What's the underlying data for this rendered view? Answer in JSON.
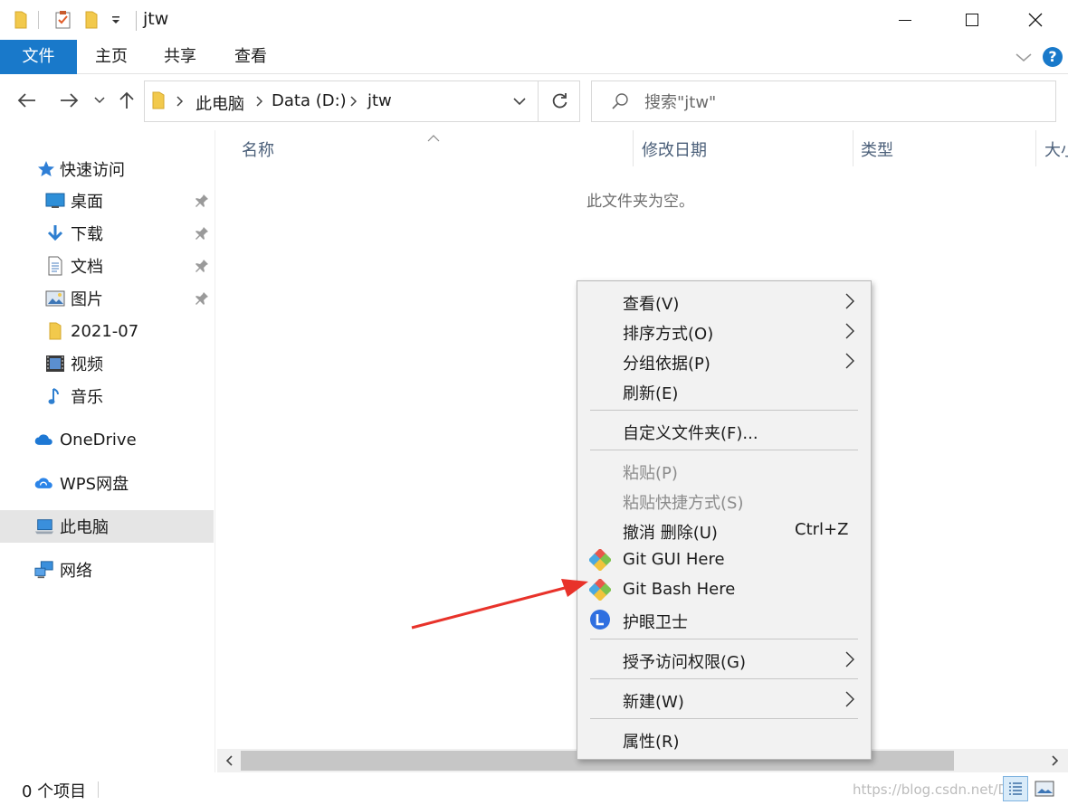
{
  "window": {
    "title": "jtw"
  },
  "ribbon": {
    "tabs": [
      {
        "label": "文件"
      },
      {
        "label": "主页"
      },
      {
        "label": "共享"
      },
      {
        "label": "查看"
      }
    ],
    "help": "?"
  },
  "address": {
    "crumbs": [
      "此电脑",
      "Data (D:)",
      "jtw"
    ]
  },
  "search": {
    "placeholder": "搜索\"jtw\""
  },
  "sidebar": {
    "items": [
      {
        "label": "快速访问",
        "icon": "star-icon"
      },
      {
        "label": "桌面",
        "icon": "desktop-icon",
        "pinned": true
      },
      {
        "label": "下载",
        "icon": "download-icon",
        "pinned": true
      },
      {
        "label": "文档",
        "icon": "document-icon",
        "pinned": true
      },
      {
        "label": "图片",
        "icon": "picture-icon",
        "pinned": true
      },
      {
        "label": "2021-07",
        "icon": "folder-icon"
      },
      {
        "label": "视频",
        "icon": "video-icon"
      },
      {
        "label": "音乐",
        "icon": "music-icon"
      },
      {
        "label": "OneDrive",
        "icon": "onedrive-icon"
      },
      {
        "label": "WPS网盘",
        "icon": "wps-cloud-icon"
      },
      {
        "label": "此电脑",
        "icon": "computer-icon",
        "selected": true
      },
      {
        "label": "网络",
        "icon": "network-icon"
      }
    ]
  },
  "columns": [
    "名称",
    "修改日期",
    "类型",
    "大小"
  ],
  "content": {
    "empty_message": "此文件夹为空。"
  },
  "status": {
    "item_count": "0 个项目",
    "watermark": "https://blog.csdn.net/De..."
  },
  "context_menu": {
    "items": [
      {
        "label": "查看(V)",
        "submenu": true
      },
      {
        "label": "排序方式(O)",
        "submenu": true
      },
      {
        "label": "分组依据(P)",
        "submenu": true
      },
      {
        "label": "刷新(E)"
      },
      {
        "label": "自定义文件夹(F)..."
      },
      {
        "label": "粘贴(P)",
        "disabled": true
      },
      {
        "label": "粘贴快捷方式(S)",
        "disabled": true
      },
      {
        "label": "撤消 删除(U)",
        "shortcut": "Ctrl+Z"
      },
      {
        "label": "Git GUI Here",
        "icon": "git-icon"
      },
      {
        "label": "Git Bash Here",
        "icon": "git-icon"
      },
      {
        "label": "护眼卫士",
        "icon": "eye-guard-icon"
      },
      {
        "label": "授予访问权限(G)",
        "submenu": true
      },
      {
        "label": "新建(W)",
        "submenu": true
      },
      {
        "label": "属性(R)"
      }
    ]
  },
  "colors": {
    "accent": "#1979ca",
    "folder": "#f2c94c",
    "arrow": "#e8322a"
  }
}
